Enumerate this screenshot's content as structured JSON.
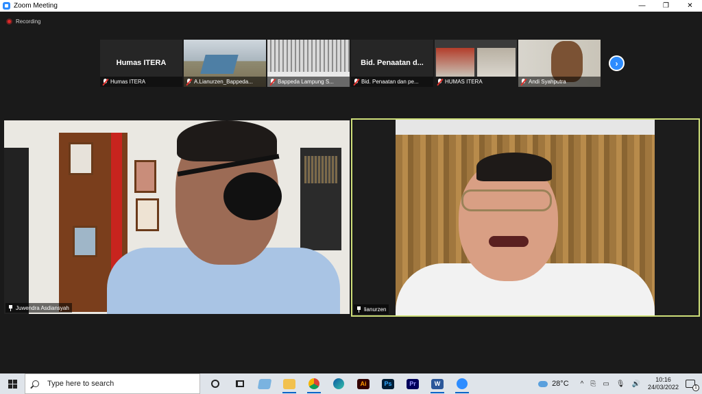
{
  "window": {
    "title": "Zoom Meeting",
    "controls": {
      "minimize": "—",
      "maximize": "❐",
      "close": "✕"
    }
  },
  "recording": {
    "label": "Recording",
    "color": "#e02828"
  },
  "thumbnails": [
    {
      "big_label": "Humas ITERA",
      "caption": "Humas ITERA",
      "video": "none",
      "muted": true
    },
    {
      "big_label": "",
      "caption": "A.Lianurzen_Bappeda...",
      "video": "office",
      "muted": true
    },
    {
      "big_label": "",
      "caption": "Bappeda Lampung S...",
      "video": "curtain",
      "muted": true
    },
    {
      "big_label": "Bid. Penaatan d...",
      "caption": "Bid. Penaatan dan pe...",
      "video": "none",
      "muted": true
    },
    {
      "big_label": "",
      "caption": "HUMAS ITERA",
      "video": "twin",
      "muted": true
    },
    {
      "big_label": "",
      "caption": "Andi Syahputra",
      "video": "person",
      "muted": true
    }
  ],
  "next_page_icon": "chevron-right-icon",
  "speakers": [
    {
      "name": "Juwendra Asdiansyah",
      "active": false
    },
    {
      "name": "lianurzen",
      "active": true,
      "highlight_color": "#cfe07a"
    }
  ],
  "taskbar": {
    "search_placeholder": "Type here to search",
    "apps": [
      "cortana-icon",
      "task-view-icon",
      "file-explorer-icon",
      "folder-icon",
      "chrome-icon",
      "edge-icon",
      "illustrator-icon",
      "photoshop-icon",
      "premiere-icon",
      "word-icon",
      "zoom-icon"
    ],
    "app_labels": {
      "illustrator": "Ai",
      "photoshop": "Ps",
      "premiere": "Pr",
      "word": "W"
    },
    "weather": "28°C",
    "tray_symbols": {
      "chevron": "^",
      "meet": "⎘",
      "network": "▭",
      "mic": "🎙",
      "volume": "🔊"
    },
    "time": "10:16",
    "date": "24/03/2022",
    "notification_count": "1"
  }
}
